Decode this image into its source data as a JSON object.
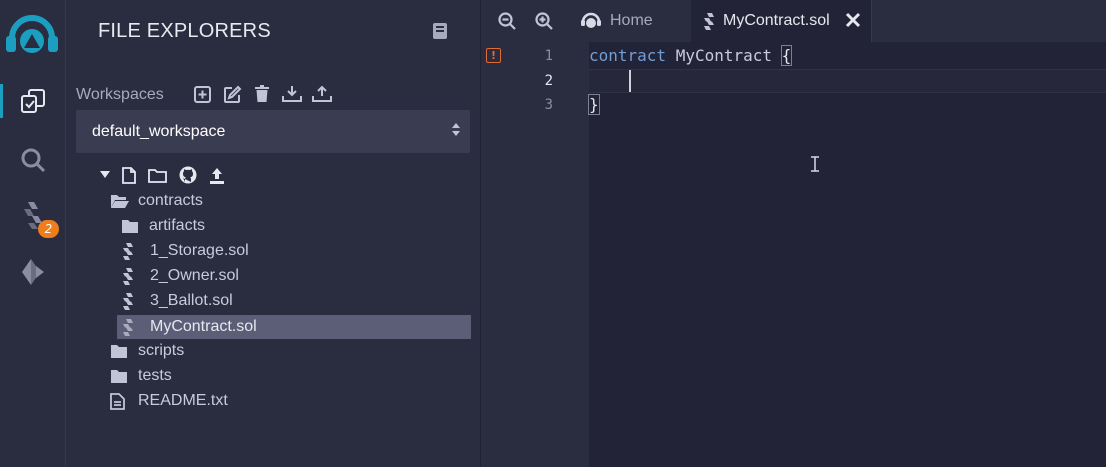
{
  "rail": {
    "items": [
      "file-explorer",
      "search",
      "solidity-compiler",
      "deploy-run"
    ],
    "compiler_badge": "2"
  },
  "explorer": {
    "title": "FILE EXPLORERS",
    "workspaces_label": "Workspaces",
    "workspace_selected": "default_workspace",
    "tree": [
      {
        "label": "contracts",
        "type": "folder-open",
        "depth": 0
      },
      {
        "label": "artifacts",
        "type": "folder",
        "depth": 1
      },
      {
        "label": "1_Storage.sol",
        "type": "sol",
        "depth": 1
      },
      {
        "label": "2_Owner.sol",
        "type": "sol",
        "depth": 1
      },
      {
        "label": "3_Ballot.sol",
        "type": "sol",
        "depth": 1
      },
      {
        "label": "MyContract.sol",
        "type": "sol",
        "depth": 1,
        "selected": true
      },
      {
        "label": "scripts",
        "type": "folder",
        "depth": 0
      },
      {
        "label": "tests",
        "type": "folder",
        "depth": 0
      },
      {
        "label": "README.txt",
        "type": "file",
        "depth": 0
      }
    ]
  },
  "editor": {
    "tabs": [
      {
        "label": "Home",
        "active": false
      },
      {
        "label": "MyContract.sol",
        "active": true
      }
    ],
    "line_numbers": [
      "1",
      "2",
      "3"
    ],
    "current_line": 2,
    "code": {
      "line1_keyword": "contract",
      "line1_name": "MyContract",
      "line1_brace": "{",
      "line3_brace": "}"
    }
  },
  "colors": {
    "accent": "#1c9ec1",
    "badge": "#ef7d1c",
    "warning": "#e36a31",
    "keyword": "#6f9ed8"
  }
}
